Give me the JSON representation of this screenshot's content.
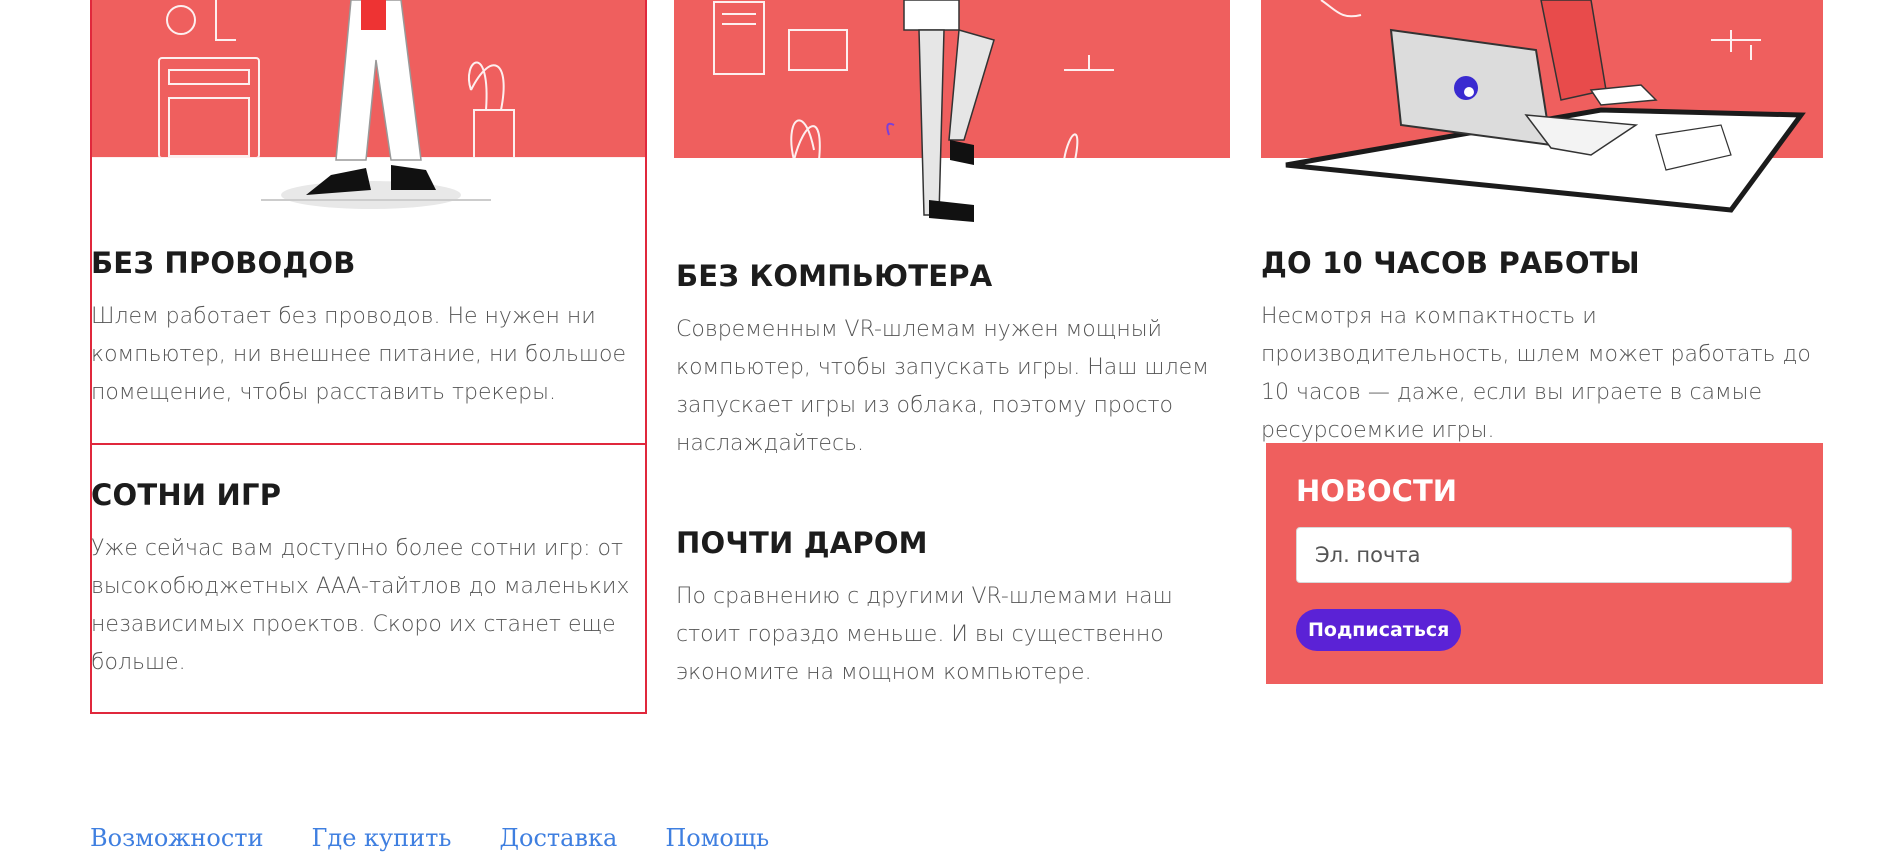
{
  "features": [
    {
      "title": "БЕЗ ПРОВОДОВ",
      "text": "Шлем работает без проводов. Не нужен ни компьютер, ни внешнее питание, ни большое помещение, чтобы расставить трекеры."
    },
    {
      "title": "БЕЗ КОМПЬЮТЕРА",
      "text": "Современным VR-шлемам нужен мощный компьютер, чтобы запускать игры. Наш шлем запускает игры из облака, поэтому просто наслаждайтесь."
    },
    {
      "title": "ДО 10 ЧАСОВ РАБОТЫ",
      "text": "Несмотря на компактность и производительность, шлем может работать до 10 часов — даже, если вы играете в самые ресурсоемкие игры."
    },
    {
      "title": "СОТНИ ИГР",
      "text": "Уже сейчас вам доступно более сотни игр: от высокобюджетных ААА-тайтлов до маленьких независимых проектов. Скоро их станет еще больше."
    },
    {
      "title": "ПОЧТИ ДАРОМ",
      "text": "По сравнению с другими VR-шлемами наш стоит гораздо меньше. И вы существенно экономите на мощном компьютере."
    }
  ],
  "newsletter": {
    "title": "НОВОСТИ",
    "email_placeholder": "Эл. почта",
    "button_label": "Подписаться"
  },
  "footer_nav": [
    "Возможности",
    "Где купить",
    "Доставка",
    "Помощь"
  ],
  "colors": {
    "accent": "#ef5f5e",
    "button": "#5b22d6",
    "link": "#3f7fe0",
    "outline": "#e0283c"
  }
}
